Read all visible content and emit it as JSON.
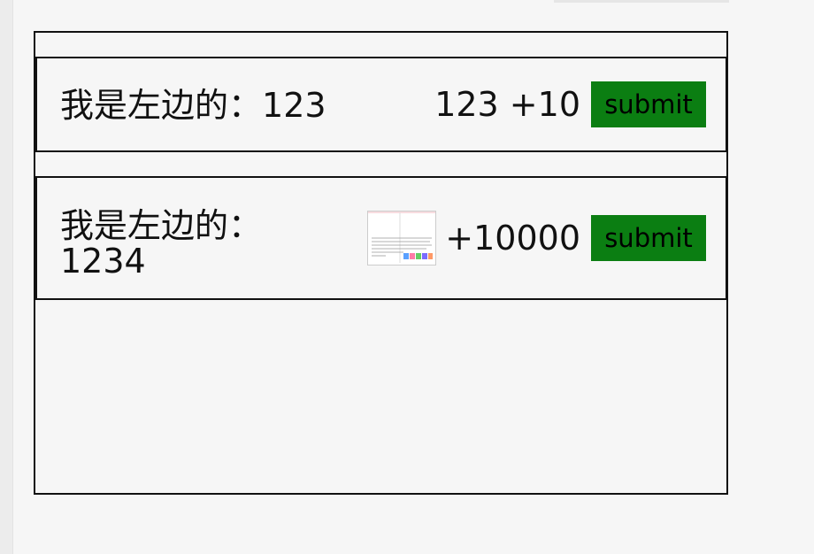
{
  "row1": {
    "label": "我是左边的：",
    "value": "123",
    "amount": "123 +10",
    "submit_label": "submit"
  },
  "row2": {
    "label": "我是左边的：",
    "value": "1234",
    "amount": "+10000",
    "submit_label": "submit",
    "image_icon": "document-thumbnail"
  }
}
